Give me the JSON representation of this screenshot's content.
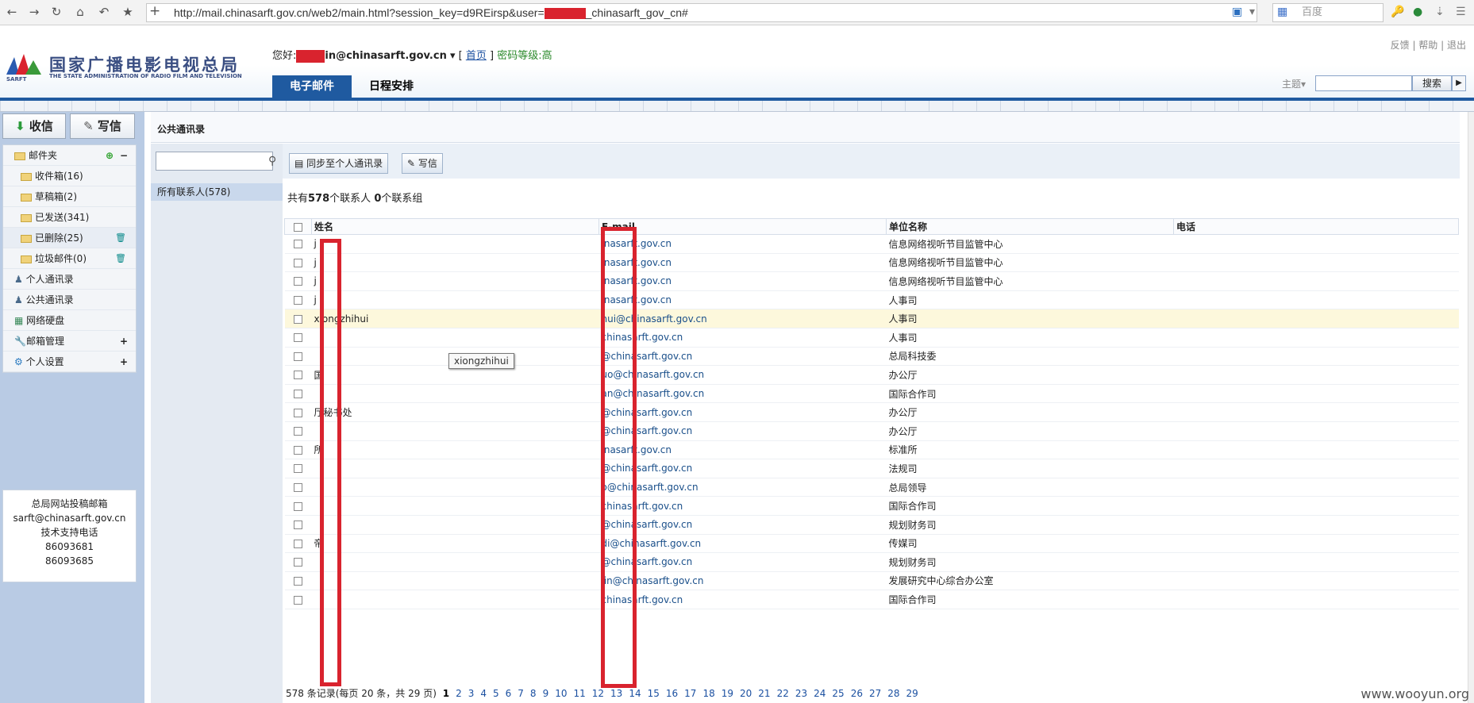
{
  "browser": {
    "url_before": "http://mail.chinasarft.gov.cn/web2/main.html?session_key=d9REirsp&user=",
    "url_after": "_chinasarft_gov_cn#",
    "search_placeholder": "百度",
    "icons": [
      "back-icon",
      "forward-icon",
      "reload-icon",
      "home-icon",
      "history-icon",
      "bookmark-icon",
      "new-tab-icon"
    ]
  },
  "header": {
    "logo_cn": "国家广播电影电视总局",
    "logo_en": "THE STATE ADMINISTRATION OF RADIO FILM AND TELEVISION",
    "logo_abbr": "SARFT",
    "greeting": "您好:",
    "user_email_suffix": "in@chinasarft.gov.cn",
    "home_link": "首页",
    "password_level": "密码等级:高",
    "top_links": [
      "反馈",
      "帮助",
      "退出"
    ],
    "tabs": [
      "电子邮件",
      "日程安排"
    ],
    "subject_label": "主题",
    "search_button": "搜索"
  },
  "sidebar": {
    "receive": "收信",
    "compose": "写信",
    "folders_header": "邮件夹",
    "folders": [
      {
        "label": "收件箱(16)"
      },
      {
        "label": "草稿箱(2)"
      },
      {
        "label": "已发送(341)"
      },
      {
        "label": "已删除(25)"
      },
      {
        "label": "垃圾邮件(0)"
      }
    ],
    "nav": [
      "个人通讯录",
      "公共通讯录",
      "网络硬盘",
      "邮箱管理",
      "个人设置"
    ],
    "support": {
      "title": "总局网站投稿邮箱",
      "email": "sarft@chinasarft.gov.cn",
      "phone_label": "技术支持电话",
      "phones": [
        "86093681",
        "86093685"
      ]
    }
  },
  "main": {
    "title": "公共通讯录",
    "all_contacts": "所有联系人(578)",
    "sync_button": "同步至个人通讯录",
    "write_button": "写信",
    "summary_prefix": "共有",
    "summary_count": "578",
    "summary_mid": "个联系人",
    "summary_groups": "0",
    "summary_suffix": "个联系组",
    "columns": [
      "姓名",
      "E-mail",
      "单位名称",
      "电话"
    ],
    "rows": [
      {
        "name": "j",
        "email": "inasarft.gov.cn",
        "unit": "信息网络视听节目监管中心"
      },
      {
        "name": "j",
        "email": "inasarft.gov.cn",
        "unit": "信息网络视听节目监管中心"
      },
      {
        "name": "j",
        "email": "inasarft.gov.cn",
        "unit": "信息网络视听节目监管中心"
      },
      {
        "name": "j",
        "email": "inasarft.gov.cn",
        "unit": "人事司"
      },
      {
        "name": "xiongzhihui",
        "email": "hui@chinasarft.gov.cn",
        "unit": "人事司"
      },
      {
        "name": "",
        "email": "chinasarft.gov.cn",
        "unit": "人事司"
      },
      {
        "name": "",
        "email": "@chinasarft.gov.cn",
        "unit": "总局科技委"
      },
      {
        "name": "国",
        "email": "uo@chinasarft.gov.cn",
        "unit": "办公厅"
      },
      {
        "name": "",
        "email": "an@chinasarft.gov.cn",
        "unit": "国际合作司"
      },
      {
        "name": "厅秘书处",
        "email": "@chinasarft.gov.cn",
        "unit": "办公厅"
      },
      {
        "name": "",
        "email": "@chinasarft.gov.cn",
        "unit": "办公厅"
      },
      {
        "name": "所",
        "email": "inasarft.gov.cn",
        "unit": "标准所"
      },
      {
        "name": "",
        "email": "@chinasarft.gov.cn",
        "unit": "法规司"
      },
      {
        "name": "",
        "email": "o@chinasarft.gov.cn",
        "unit": "总局领导"
      },
      {
        "name": "",
        "email": "chinasarft.gov.cn",
        "unit": "国际合作司"
      },
      {
        "name": "",
        "email": "@chinasarft.gov.cn",
        "unit": "规划财务司"
      },
      {
        "name": "帝",
        "email": "di@chinasarft.gov.cn",
        "unit": "传媒司"
      },
      {
        "name": "",
        "email": "@chinasarft.gov.cn",
        "unit": "规划财务司"
      },
      {
        "name": "",
        "email": "jin@chinasarft.gov.cn",
        "unit": "发展研究中心综合办公室"
      },
      {
        "name": "",
        "email": "chinasarft.gov.cn",
        "unit": "国际合作司"
      }
    ],
    "tooltip": "xiongzhihui",
    "pager_text": "578 条记录(每页 20 条，共 29 页)",
    "pages": [
      "1",
      "2",
      "3",
      "4",
      "5",
      "6",
      "7",
      "8",
      "9",
      "10",
      "11",
      "12",
      "13",
      "14",
      "15",
      "16",
      "17",
      "18",
      "19",
      "20",
      "21",
      "22",
      "23",
      "24",
      "25",
      "26",
      "27",
      "28",
      "29"
    ],
    "current_page": "1"
  },
  "watermark": "www.wooyun.org",
  "colors": {
    "nav_blue": "#1f5aa0",
    "sidebar": "#b9cbe4",
    "redaction": "#d9232e",
    "highlight_row": "#fdf8dc"
  }
}
